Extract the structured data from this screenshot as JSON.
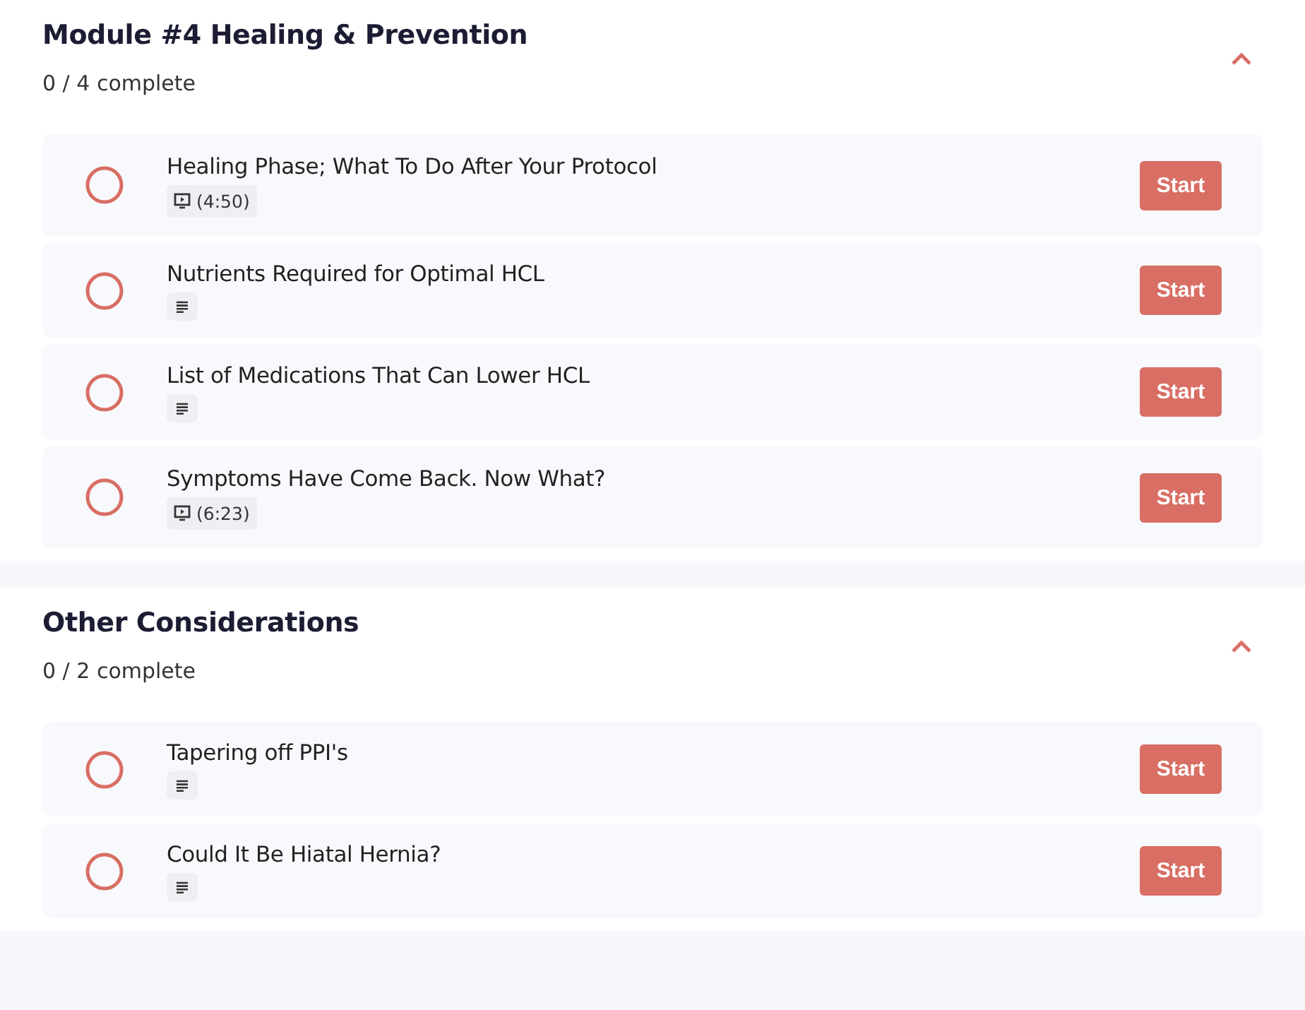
{
  "sections": [
    {
      "title": "Module #4 Healing & Prevention",
      "progress": "0 / 4 complete",
      "expanded": true,
      "lessons": [
        {
          "title": "Healing Phase; What To Do After Your Protocol",
          "kind": "video",
          "duration": "(4:50)",
          "completed": false,
          "button": "Start"
        },
        {
          "title": "Nutrients Required for Optimal HCL",
          "kind": "text",
          "completed": false,
          "button": "Start"
        },
        {
          "title": "List of Medications That Can Lower HCL",
          "kind": "text",
          "completed": false,
          "button": "Start"
        },
        {
          "title": "Symptoms Have Come Back. Now What?",
          "kind": "video",
          "duration": "(6:23)",
          "completed": false,
          "button": "Start"
        }
      ]
    },
    {
      "title": "Other Considerations",
      "progress": "0 / 2 complete",
      "expanded": true,
      "lessons": [
        {
          "title": "Tapering off PPI's",
          "kind": "text",
          "completed": false,
          "button": "Start"
        },
        {
          "title": "Could It Be Hiatal Hernia?",
          "kind": "text",
          "completed": false,
          "button": "Start"
        }
      ]
    }
  ]
}
